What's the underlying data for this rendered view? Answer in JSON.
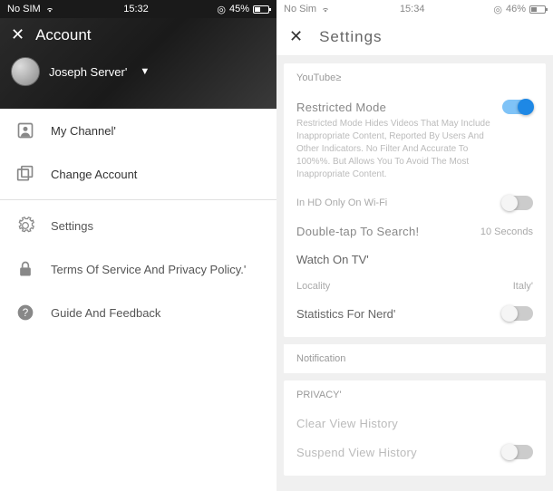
{
  "left": {
    "status": {
      "carrier": "No SIM",
      "time": "15:32",
      "battery": "45%",
      "battery_icon": "◎"
    },
    "header": {
      "title": "Account",
      "username": "Joseph Server'"
    },
    "menu": {
      "my_channel": "My Channel'",
      "change_account": "Change Account",
      "settings": "Settings",
      "terms": "Terms Of Service And Privacy Policy.'",
      "guide": "Guide And Feedback"
    }
  },
  "right": {
    "status": {
      "carrier": "No Sim",
      "time": "15:34",
      "battery": "46%",
      "battery_icon": "◎"
    },
    "header": {
      "title": "Settings"
    },
    "youtube_label": "YouTube≥",
    "restricted": {
      "title": "Restricted Mode",
      "desc": "Restricted Mode Hides Videos That May Include Inappropriate Content, Reported By Users And Other Indicators. No Filter And Accurate To 100%%. But Allows You To Avoid The Most Inappropriate Content."
    },
    "hd_wifi": "In HD Only On Wi-Fi",
    "double_tap": {
      "label": "Double-tap To Search!",
      "value": "10 Seconds"
    },
    "watch_tv": "Watch On TV'",
    "locality": {
      "label": "Locality",
      "value": "Italy'"
    },
    "stats": "Statistics For Nerd'",
    "notification": "Notification",
    "privacy_label": "PRIVACY'",
    "clear_history": "Clear View History",
    "suspend_history": "Suspend View History"
  }
}
